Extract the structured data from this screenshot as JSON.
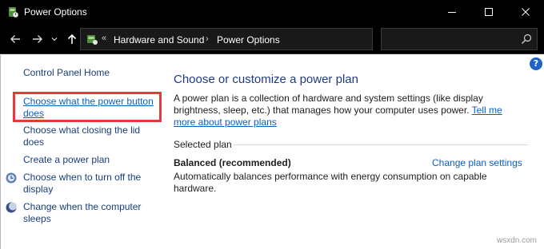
{
  "window": {
    "title": "Power Options",
    "icons": {
      "app": "power-options-icon",
      "minimize": "minimize-icon",
      "maximize": "maximize-icon",
      "close": "close-icon"
    }
  },
  "addressbar": {
    "overflow_chevron": "«",
    "breadcrumbs": [
      "Hardware and Sound",
      "Power Options"
    ],
    "separator": "›",
    "search_placeholder": ""
  },
  "sidebar": {
    "home": "Control Panel Home",
    "items": [
      {
        "label": "Choose what the power button does",
        "icon": null,
        "highlighted": true
      },
      {
        "label": "Choose what closing the lid does",
        "icon": null,
        "highlighted": false
      },
      {
        "label": "Create a power plan",
        "icon": null,
        "highlighted": false
      },
      {
        "label": "Choose when to turn off the display",
        "icon": "display-icon",
        "highlighted": false
      },
      {
        "label": "Change when the computer sleeps",
        "icon": "sleep-moon-icon",
        "highlighted": false
      }
    ]
  },
  "main": {
    "title": "Choose or customize a power plan",
    "description": "A power plan is a collection of hardware and system settings (like display brightness, sleep, etc.) that manages how your computer uses power.",
    "learn_more_link": "Tell me more about power plans",
    "section_label": "Selected plan",
    "plan": {
      "name": "Balanced (recommended)",
      "settings_link": "Change plan settings",
      "description": "Automatically balances performance with energy consumption on capable hardware."
    }
  },
  "help": "?",
  "watermark": "wsxdn.com",
  "colors": {
    "titlebar": "#000000",
    "link": "#0b5fc4",
    "nav_link": "#1a3e7a",
    "heading": "#1e3a87",
    "highlight_box": "#e43a3a"
  }
}
